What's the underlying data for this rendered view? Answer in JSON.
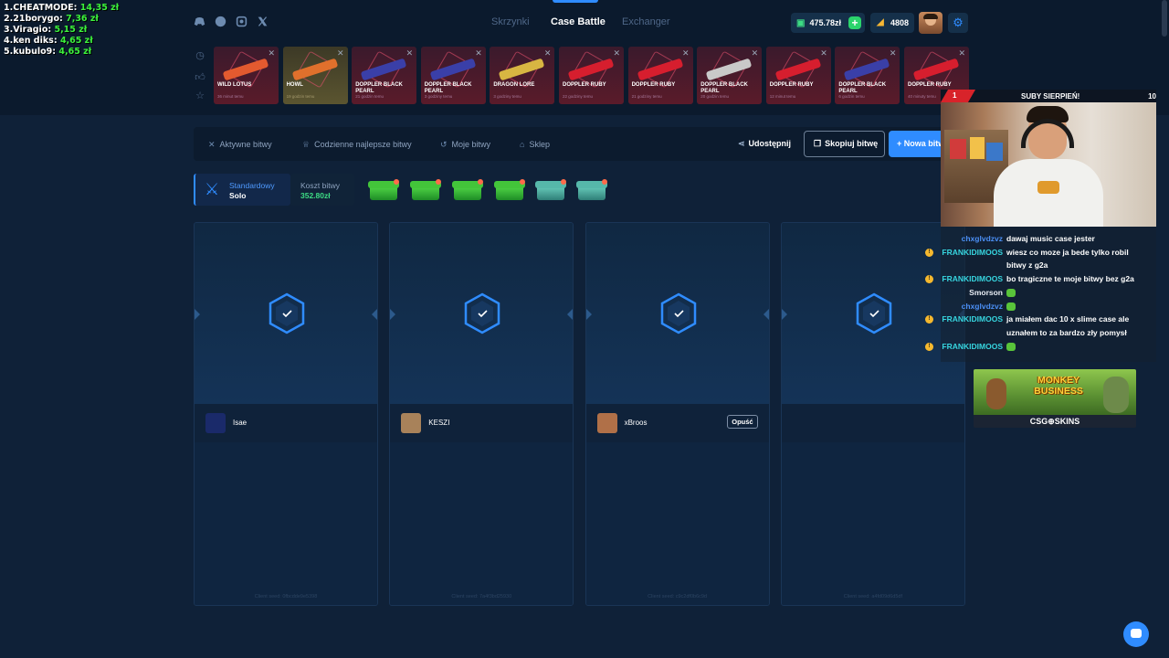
{
  "leaderboard": [
    {
      "rank": "1.CHEATMODE:",
      "amount": "14,35 zł"
    },
    {
      "rank": "2.21borygo:",
      "amount": "7,36 zł"
    },
    {
      "rank": "3.Viragio:",
      "amount": "5,15 zł"
    },
    {
      "rank": "4.ken diks:",
      "amount": "4,65 zł"
    },
    {
      "rank": "5.kubulo9:",
      "amount": "4,65 zł"
    }
  ],
  "nav": {
    "cases": "Skrzynki",
    "battle": "Case Battle",
    "exchanger": "Exchanger"
  },
  "wallet": {
    "balance": "475.78zł",
    "coins": "4808"
  },
  "drops": [
    {
      "name": "WILD LOTUS",
      "time": "36 minut temu",
      "theme": "red",
      "gun": "#e35a2f"
    },
    {
      "name": "HOWL",
      "time": "19 godzin temu",
      "theme": "gold",
      "gun": "#e0702c"
    },
    {
      "name": "DOPPLER BLACK PEARL",
      "time": "21 godzin temu",
      "theme": "red",
      "gun": "#3a3fa8"
    },
    {
      "name": "DOPPLER BLACK PEARL",
      "time": "3 godziny temu",
      "theme": "red",
      "gun": "#3a3fa8"
    },
    {
      "name": "DRAGON LORE",
      "time": "3 godziny temu",
      "theme": "red",
      "gun": "#d8b642"
    },
    {
      "name": "DOPPLER RUBY",
      "time": "22 godziny temu",
      "theme": "red",
      "gun": "#d61e2e"
    },
    {
      "name": "DOPPLER RUBY",
      "time": "21 godziny temu",
      "theme": "red",
      "gun": "#d61e2e"
    },
    {
      "name": "DOPPLER BLACK PEARL",
      "time": "20 godzin temu",
      "theme": "red",
      "gun": "#c9c9c9"
    },
    {
      "name": "DOPPLER RUBY",
      "time": "12 minut temu",
      "theme": "red",
      "gun": "#d61e2e"
    },
    {
      "name": "DOPPLER BLACK PEARL",
      "time": "6 godzin temu",
      "theme": "red",
      "gun": "#3a3fa8"
    },
    {
      "name": "DOPPLER RUBY",
      "time": "40 minuty temu",
      "theme": "red",
      "gun": "#d61e2e"
    }
  ],
  "tabs": {
    "active": "Aktywne bitwy",
    "daily": "Codzienne najlepsze bitwy",
    "mine": "Moje bitwy",
    "shop": "Sklep",
    "share": "Udostępnij",
    "copy": "Skopiuj bitwę",
    "new": "Nowa bitwa"
  },
  "battle": {
    "mode_label": "Standardowy",
    "mode_value": "Solo",
    "cost_label": "Koszt bitwy",
    "cost_value": "352.80zł"
  },
  "players": [
    {
      "name": "Isae",
      "seed": "Client seed: 0fbcdde9e5398",
      "avatar": "#1a2a6a",
      "leave": ""
    },
    {
      "name": "KESZI",
      "seed": "Client seed: 7a4f3bd25930",
      "avatar": "#a8825a",
      "leave": ""
    },
    {
      "name": "xBroos",
      "seed": "Client seed: c9c2df0b6c9d",
      "avatar": "#b07048",
      "leave": "Opuść"
    },
    {
      "name": "",
      "seed": "Client seed: a4fd09d6d5df",
      "avatar": "",
      "leave": ""
    }
  ],
  "stream": {
    "sub_title": "SUBY SIERPIEŃ!",
    "sub_count": "10",
    "sub_rank": "1",
    "chat": [
      {
        "user": "chxglvdzvz",
        "text": "dawaj music case jester",
        "color": "blue",
        "badge": false
      },
      {
        "user": "FRANKIDIMOOS",
        "text": "wiesz co moze ja bede tylko robil",
        "color": "cyan",
        "badge": true
      },
      {
        "user": "",
        "text": "bitwy z g2a",
        "color": "cyan",
        "badge": false
      },
      {
        "user": "FRANKIDIMOOS",
        "text": "bo tragiczne te moje bitwy bez g2a",
        "color": "cyan",
        "badge": true
      },
      {
        "user": "Smorson",
        "text": "",
        "color": "white",
        "badge": false
      },
      {
        "user": "chxglvdzvz",
        "text": "",
        "color": "blue",
        "badge": false
      },
      {
        "user": "FRANKIDIMOOS",
        "text": "ja miałem dac 10 x slime case ale",
        "color": "cyan",
        "badge": true
      },
      {
        "user": "",
        "text": "uznałem to za bardzo zły pomysł",
        "color": "cyan",
        "badge": false
      },
      {
        "user": "FRANKIDIMOOS",
        "text": "",
        "color": "cyan",
        "badge": true
      }
    ],
    "ad_title": "MONKEY BUSINESS",
    "ad_brand": "CSG⊕SKINS"
  },
  "colors": {
    "accent": "#2f8cff",
    "money": "#3ddc84",
    "bg": "#0f2138"
  }
}
